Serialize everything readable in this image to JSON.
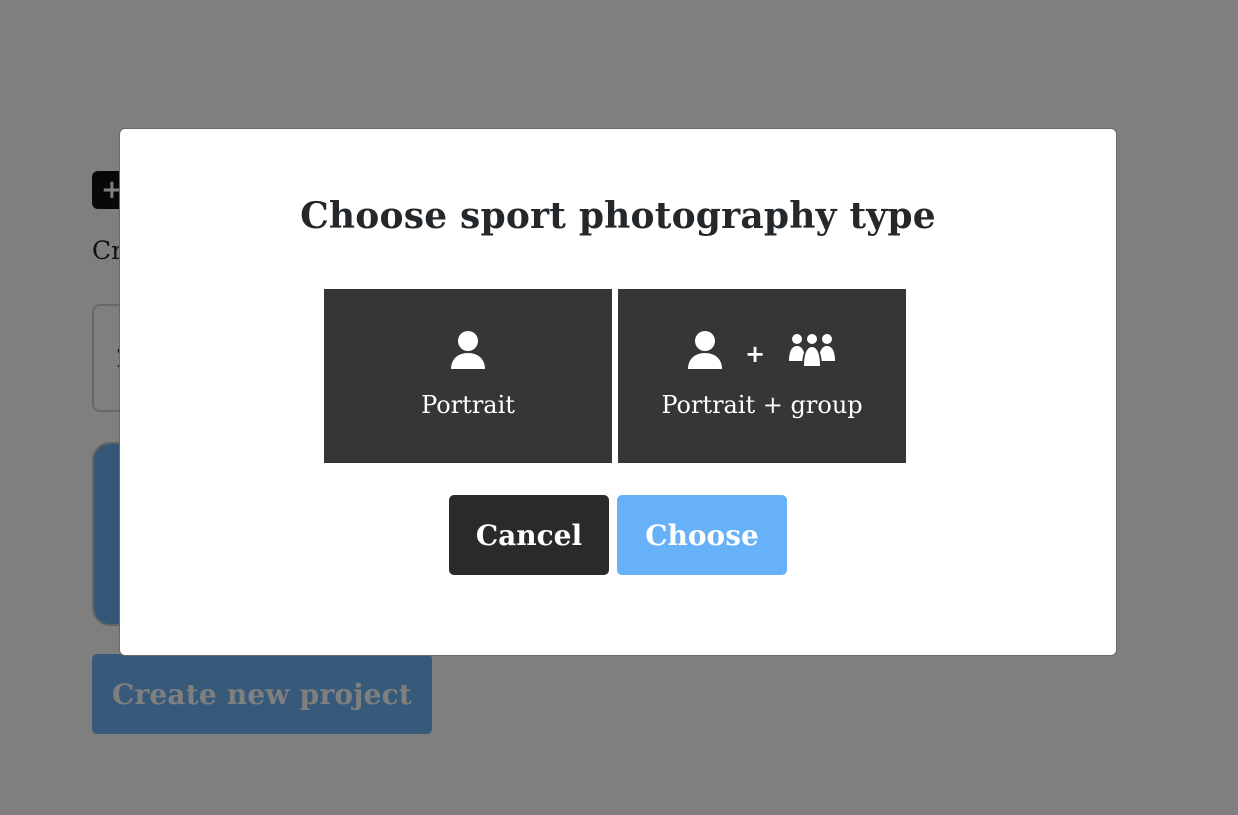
{
  "background": {
    "add_button_icon": "plus-icon",
    "add_button_glyph": "+",
    "created_text": "Cr",
    "input_value": "2",
    "create_project_label": "Create new project"
  },
  "modal": {
    "title": "Choose sport photography type",
    "options": [
      {
        "label": "Portrait",
        "icons": [
          "person-icon"
        ]
      },
      {
        "label": "Portrait + group",
        "plus": "+",
        "icons": [
          "person-icon",
          "group-icon"
        ]
      }
    ],
    "cancel_label": "Cancel",
    "choose_label": "Choose"
  },
  "colors": {
    "overlay": "rgba(0,0,0,0.5)",
    "option_bg": "#363636",
    "cancel_bg": "#2a2a2a",
    "choose_bg": "#67b1f9",
    "create_project_bg": "#6fb4f7"
  }
}
